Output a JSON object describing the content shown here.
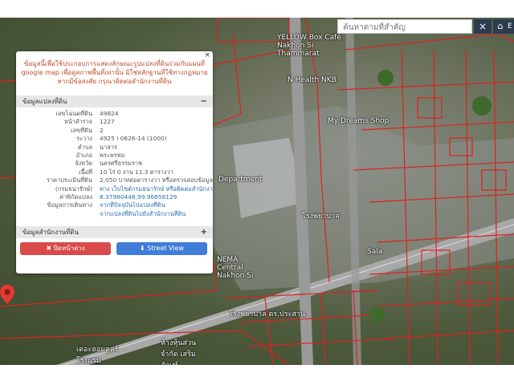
{
  "search": {
    "placeholder": "ค้นหาตามที่สำคัญ"
  },
  "header_buttons": {
    "close": "×",
    "home": "⌂",
    "edge": "E"
  },
  "map_labels": [
    "YELLOW Box Café Nakhon Si Thammarat",
    "N Health NKB",
    "My Dreams Shop",
    "Department",
    "โรงพยาบาล",
    "Sala",
    "NEMA Central Nakhon Si",
    "โรงพยาบาล ดร.ประสาน",
    "ห้างหุ้นส่วนจำกัด เสริมภัณฑ์",
    "เดอะฮอมคูลร์ โรงแรม"
  ],
  "popup": {
    "close": "×",
    "notice": "ข้อมูลนี้เพื่อใช้ประกอบการแสดงลักษณะรูปแปลงที่ดินร่วมกับแผนที่ google map เพื่อดูสภาพพื้นที่เท่านั้น มิใช่หลักฐานที่ใช้ทางกฎหมาย หากมีข้อสงสัย กรุณาติดต่อสำนักงานที่ดิน",
    "section1": "ข้อมูลแปลงที่ดิน",
    "section1_toggle": "−",
    "section2": "ข้อมูลสำนักงานที่ดิน",
    "section2_toggle": "+",
    "rows": [
      {
        "k": "เลขโฉนดที่ดิน",
        "v": "49824",
        "link": false
      },
      {
        "k": "หน้าสำรวจ",
        "v": "1227",
        "link": false
      },
      {
        "k": "เลขที่ดิน",
        "v": "2",
        "link": false
      },
      {
        "k": "ระวาง",
        "v": "4925 I 0626-14 (1000)",
        "link": false
      },
      {
        "k": "ตำบล",
        "v": "นาสาร",
        "link": false
      },
      {
        "k": "อำเภอ",
        "v": "พระพรหม",
        "link": false
      },
      {
        "k": "จังหวัด",
        "v": "นครศรีธรรมราช",
        "link": false
      },
      {
        "k": "เนื้อที่",
        "v": "10 ไร่ 0 งาน 11.3 ตารางวา",
        "link": false
      },
      {
        "k": "ราคาประเมินที่ดิน",
        "v": "2,050 บาทต่อตารางวา หรือตรวจสอบข้อมูลผ่าน",
        "link": false
      },
      {
        "k": "(กรมธนารักษ์)",
        "v": "ทาง เว็บไซต์กรมธนารักษ์ หรือติดต่อสำนักงานที่ดิน",
        "link": true
      },
      {
        "k": "ค่าพิกัดแปลง",
        "v": "8.37980448,99.96658129",
        "link": true
      },
      {
        "k": "ข้อมูลการเดินทาง",
        "v": "จากที่ปัจจุบันไปแปลงที่ดิน",
        "link": true
      },
      {
        "k": "",
        "v": "จากแปลงที่ดินไปยังสำนักงานที่ดิน",
        "link": true
      }
    ],
    "close_button": "✖ ปิดหน้าต่าง",
    "streetview_button": "⬇ Street View"
  },
  "colors": {
    "parcel": "#e02020",
    "accent": "#3f7dd6",
    "danger": "#d94a4a"
  }
}
